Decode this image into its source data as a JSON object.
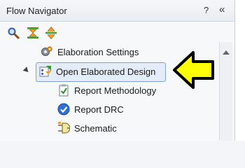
{
  "panel": {
    "title": "Flow Navigator",
    "help_label": "?",
    "collapse_label": "«"
  },
  "toolbar": {
    "icons": [
      "search-icon",
      "collapse-all-icon",
      "expand-all-icon"
    ]
  },
  "items": [
    {
      "label": "Elaboration Settings",
      "icon": "gear-settings-icon"
    },
    {
      "label": "Open Elaborated Design",
      "icon": "open-design-icon",
      "selected": true,
      "expanded": true
    },
    {
      "label": "Report Methodology",
      "icon": "report-methodology-icon"
    },
    {
      "label": "Report DRC",
      "icon": "check-circle-icon"
    },
    {
      "label": "Schematic",
      "icon": "schematic-icon"
    }
  ],
  "colors": {
    "selection_fill": "#e3ecf8",
    "selection_border": "#7fa3d3",
    "annotation_arrow_fill": "#ffff00",
    "annotation_arrow_stroke": "#000000"
  }
}
